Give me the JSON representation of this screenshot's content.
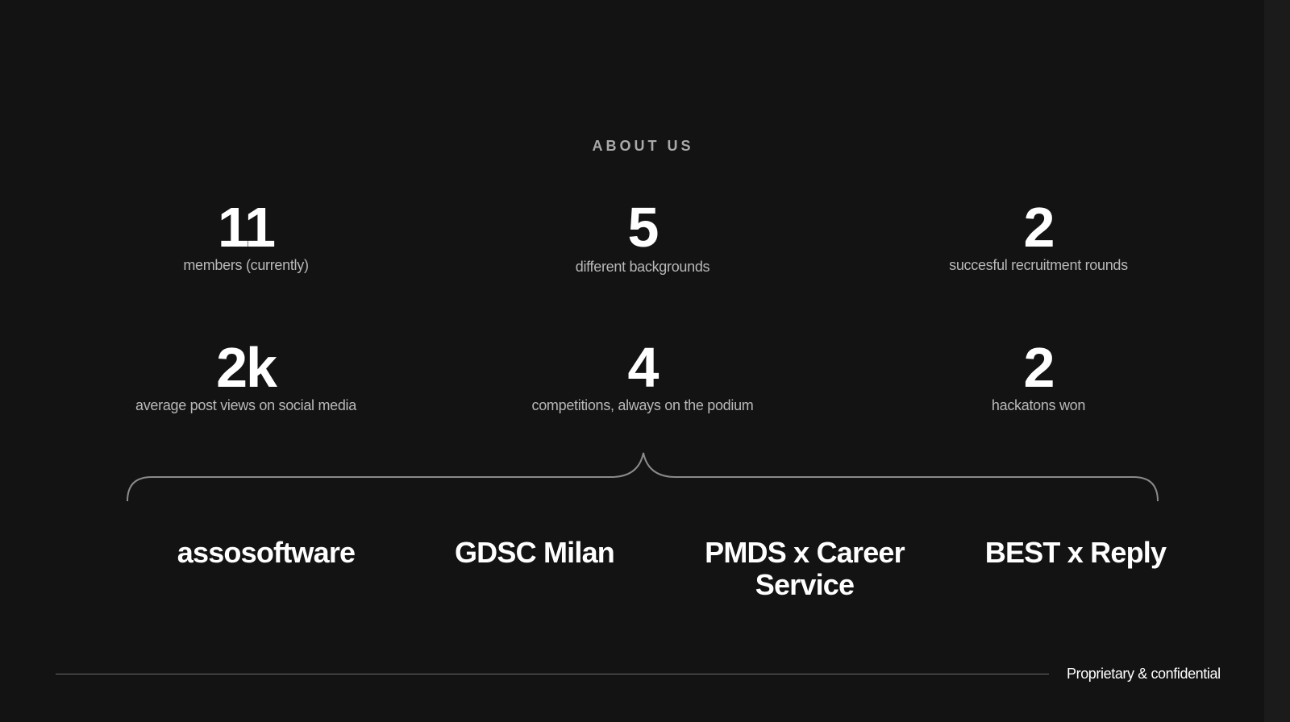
{
  "section": {
    "title": "ABOUT US"
  },
  "stats": [
    {
      "value": "11",
      "label": "members (currently)"
    },
    {
      "value": "5",
      "label": "different backgrounds"
    },
    {
      "value": "2",
      "label": "succesful recruitment rounds"
    },
    {
      "value": "2k",
      "label": "average  post views on social media"
    },
    {
      "value": "4",
      "label": "competitions, always on the podium"
    },
    {
      "value": "2",
      "label": "hackatons won"
    }
  ],
  "competitions": [
    "assosoftware",
    "GDSC Milan",
    "PMDS x Career Service",
    "BEST x Reply"
  ],
  "footer": {
    "text": "Proprietary & confidential"
  },
  "colors": {
    "background": "#131313",
    "heading": "#a9a9a9",
    "label": "#b8b8b8",
    "accent_line": "#8a8a8a"
  }
}
